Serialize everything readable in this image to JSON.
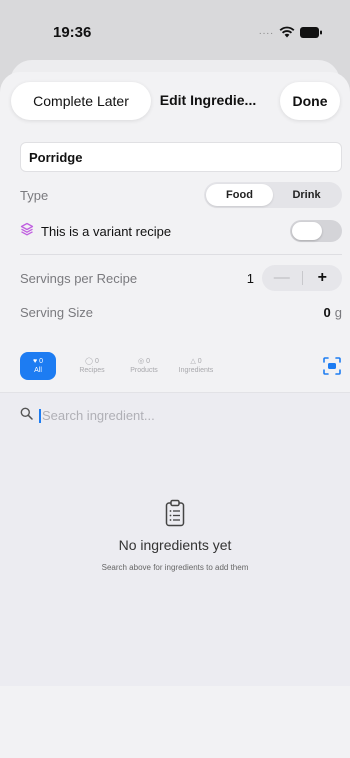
{
  "status_bar": {
    "time": "19:36",
    "signal": "....",
    "icons": [
      "wifi-icon",
      "battery-icon"
    ]
  },
  "header": {
    "complete_label": "Complete Later",
    "title": "Edit Ingredie...",
    "done_label": "Done"
  },
  "form": {
    "name_value": "Porridge",
    "type_label": "Type",
    "type_options": [
      "Food",
      "Drink"
    ],
    "type_selected": "Food",
    "variant_label": "This is a variant recipe",
    "variant_on": false,
    "servings_label": "Servings per Recipe",
    "servings_value": "1",
    "stepper_minus": "—",
    "stepper_plus": "+",
    "size_label": "Serving Size",
    "size_value": "0",
    "size_unit": "g"
  },
  "filters": [
    {
      "count": "0",
      "label": "All",
      "icon": "all-icon",
      "active": true
    },
    {
      "count": "0",
      "label": "Recipes",
      "icon": "person-icon",
      "active": false
    },
    {
      "count": "0",
      "label": "Products",
      "icon": "product-icon",
      "active": false
    },
    {
      "count": "0",
      "label": "Ingredients",
      "icon": "ingredient-icon",
      "active": false
    }
  ],
  "search": {
    "placeholder": "Search ingredient..."
  },
  "empty_state": {
    "title": "No ingredients yet",
    "subtitle": "Search above for ingredients to add them"
  },
  "colors": {
    "accent": "#1d7cf2",
    "variant_icon": "#c060e0"
  }
}
